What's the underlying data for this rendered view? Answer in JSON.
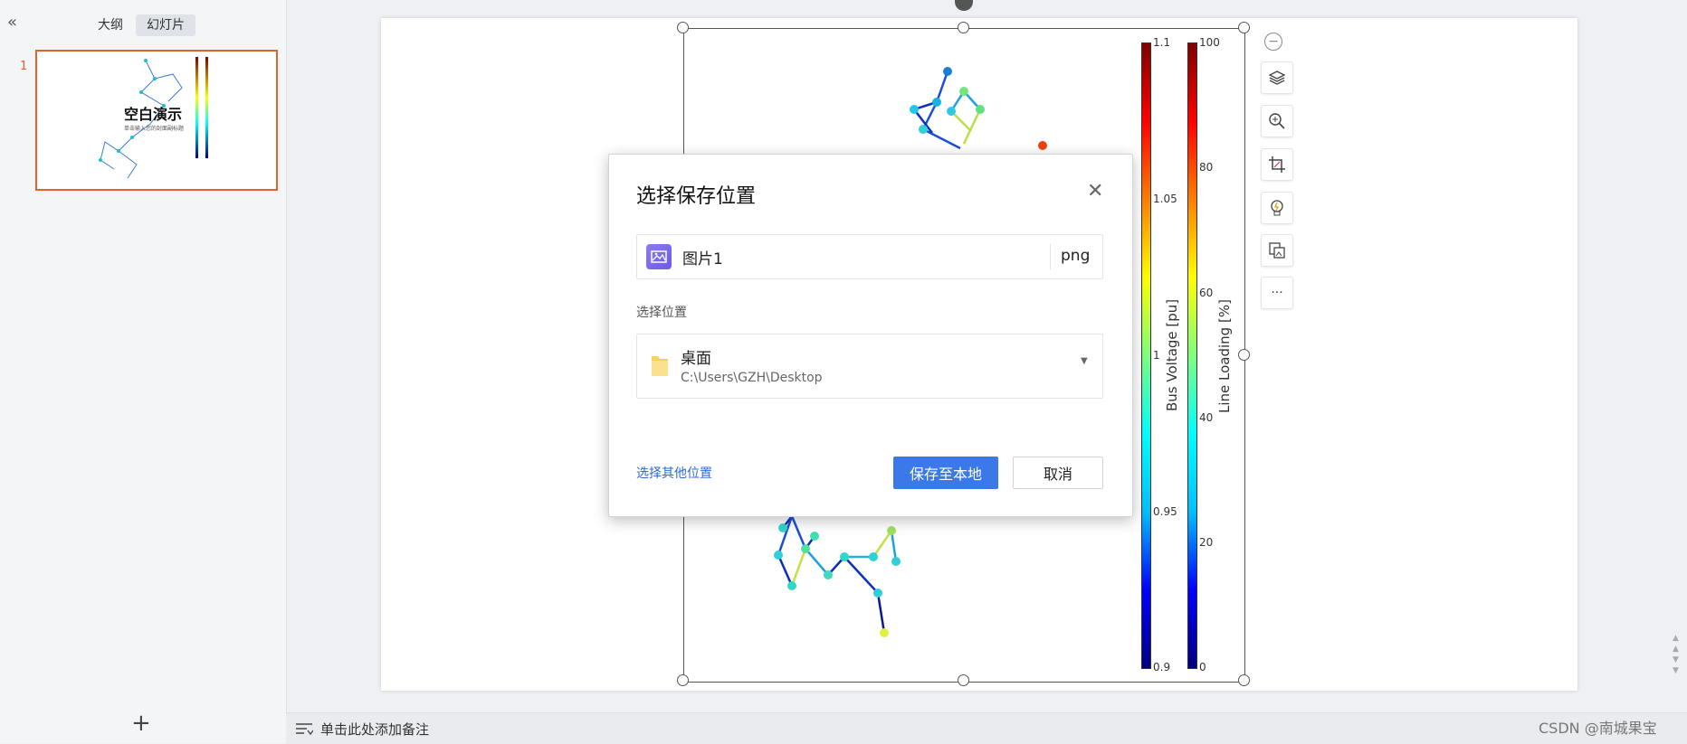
{
  "left_panel": {
    "tabs": [
      {
        "label": "大纲"
      },
      {
        "label": "幻灯片",
        "active": true
      }
    ],
    "slide_number": "1",
    "thumbnail": {
      "title": "空白演示",
      "subtitle": "单击输入您的封面副标题"
    },
    "add_icon": "plus-icon",
    "collapse_icon": "double-chevron-left-icon"
  },
  "colorbars": [
    {
      "label": "Bus Voltage [pu]",
      "ticks": [
        "1.1",
        "1.05",
        "1",
        "0.95",
        "0.9"
      ]
    },
    {
      "label": "Line Loading [%]",
      "ticks": [
        "100",
        "80",
        "60",
        "40",
        "20",
        "0"
      ]
    }
  ],
  "toolbar_icons": [
    "layers-icon",
    "zoom-in-icon",
    "crop-icon",
    "bulb-icon",
    "image-swap-icon",
    "more-icon"
  ],
  "toolbar_more_label": "···",
  "notes": {
    "placeholder": "单击此处添加备注"
  },
  "watermark": "CSDN @南城果宝",
  "dialog": {
    "title": "选择保存位置",
    "filename": "图片1",
    "extension": "png",
    "location_label": "选择位置",
    "location_name": "桌面",
    "location_path": "C:\\Users\\GZH\\Desktop",
    "other_location": "选择其他位置",
    "save_button": "保存至本地",
    "cancel_button": "取消"
  },
  "colors": {
    "accent": "#3b79e8",
    "slide_selected": "#e0632a"
  }
}
